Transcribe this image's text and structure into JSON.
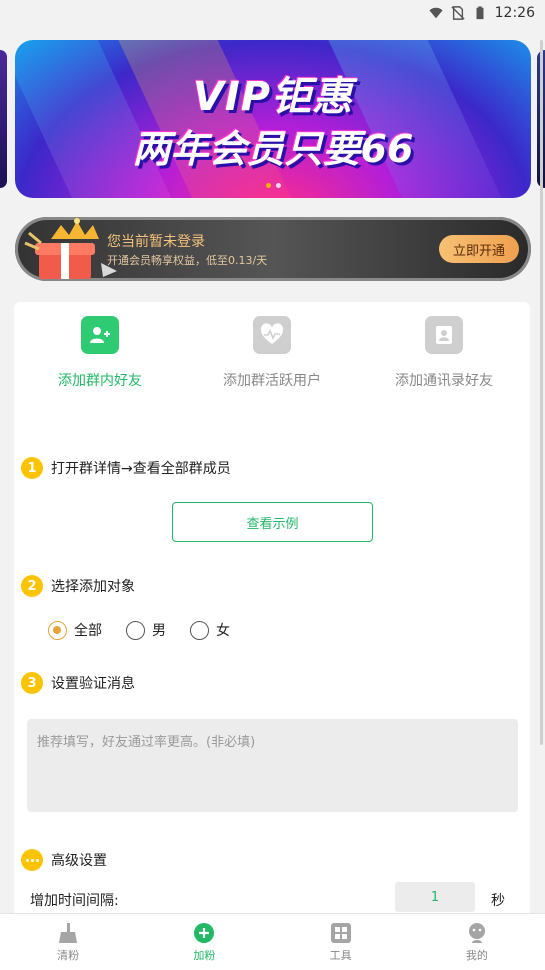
{
  "status_bar": {
    "time": "12:26",
    "icons": [
      "wifi-icon",
      "no-sim-icon",
      "battery-icon"
    ]
  },
  "banner": {
    "line1": "VIP钜惠",
    "line2": "两年会员只要66",
    "slide_count": 2,
    "active_slide": 0
  },
  "vip_bar": {
    "title": "您当前暂未登录",
    "subtitle": "开通会员畅享权益，低至0.13/天",
    "button": "立即开通"
  },
  "tabs": [
    {
      "label": "添加群内好友",
      "icon": "add-user-icon",
      "active": true,
      "color": "#2ecb72"
    },
    {
      "label": "添加群活跃用户",
      "icon": "heartbeat-icon",
      "active": false,
      "color": "#cfcfcf"
    },
    {
      "label": "添加通讯录好友",
      "icon": "contacts-icon",
      "active": false,
      "color": "#cfcfcf"
    }
  ],
  "steps": {
    "step1": {
      "num": "1",
      "text": "打开群详情→查看全部群成员"
    },
    "example_button": "查看示例",
    "step2": {
      "num": "2",
      "text": "选择添加对象"
    },
    "radio_options": [
      {
        "label": "全部",
        "checked": true
      },
      {
        "label": "男",
        "checked": false
      },
      {
        "label": "女",
        "checked": false
      }
    ],
    "step3": {
      "num": "3",
      "text": "设置验证消息"
    },
    "message_placeholder": "推荐填写，好友通过率更高。(非必填)",
    "advanced": "高级设置"
  },
  "interval": {
    "label": "增加时间间隔:",
    "value": "1",
    "unit": "秒"
  },
  "tabbar": [
    {
      "label": "清粉",
      "icon": "broom-icon",
      "active": false
    },
    {
      "label": "加粉",
      "icon": "plus-circle-icon",
      "active": true
    },
    {
      "label": "工具",
      "icon": "grid-icon",
      "active": false
    },
    {
      "label": "我的",
      "icon": "profile-icon",
      "active": false
    }
  ],
  "colors": {
    "primary_green": "#22b866",
    "step_yellow": "#fcc400",
    "radio_orange": "#e6a23c",
    "vip_gold": "#f4c27a"
  }
}
